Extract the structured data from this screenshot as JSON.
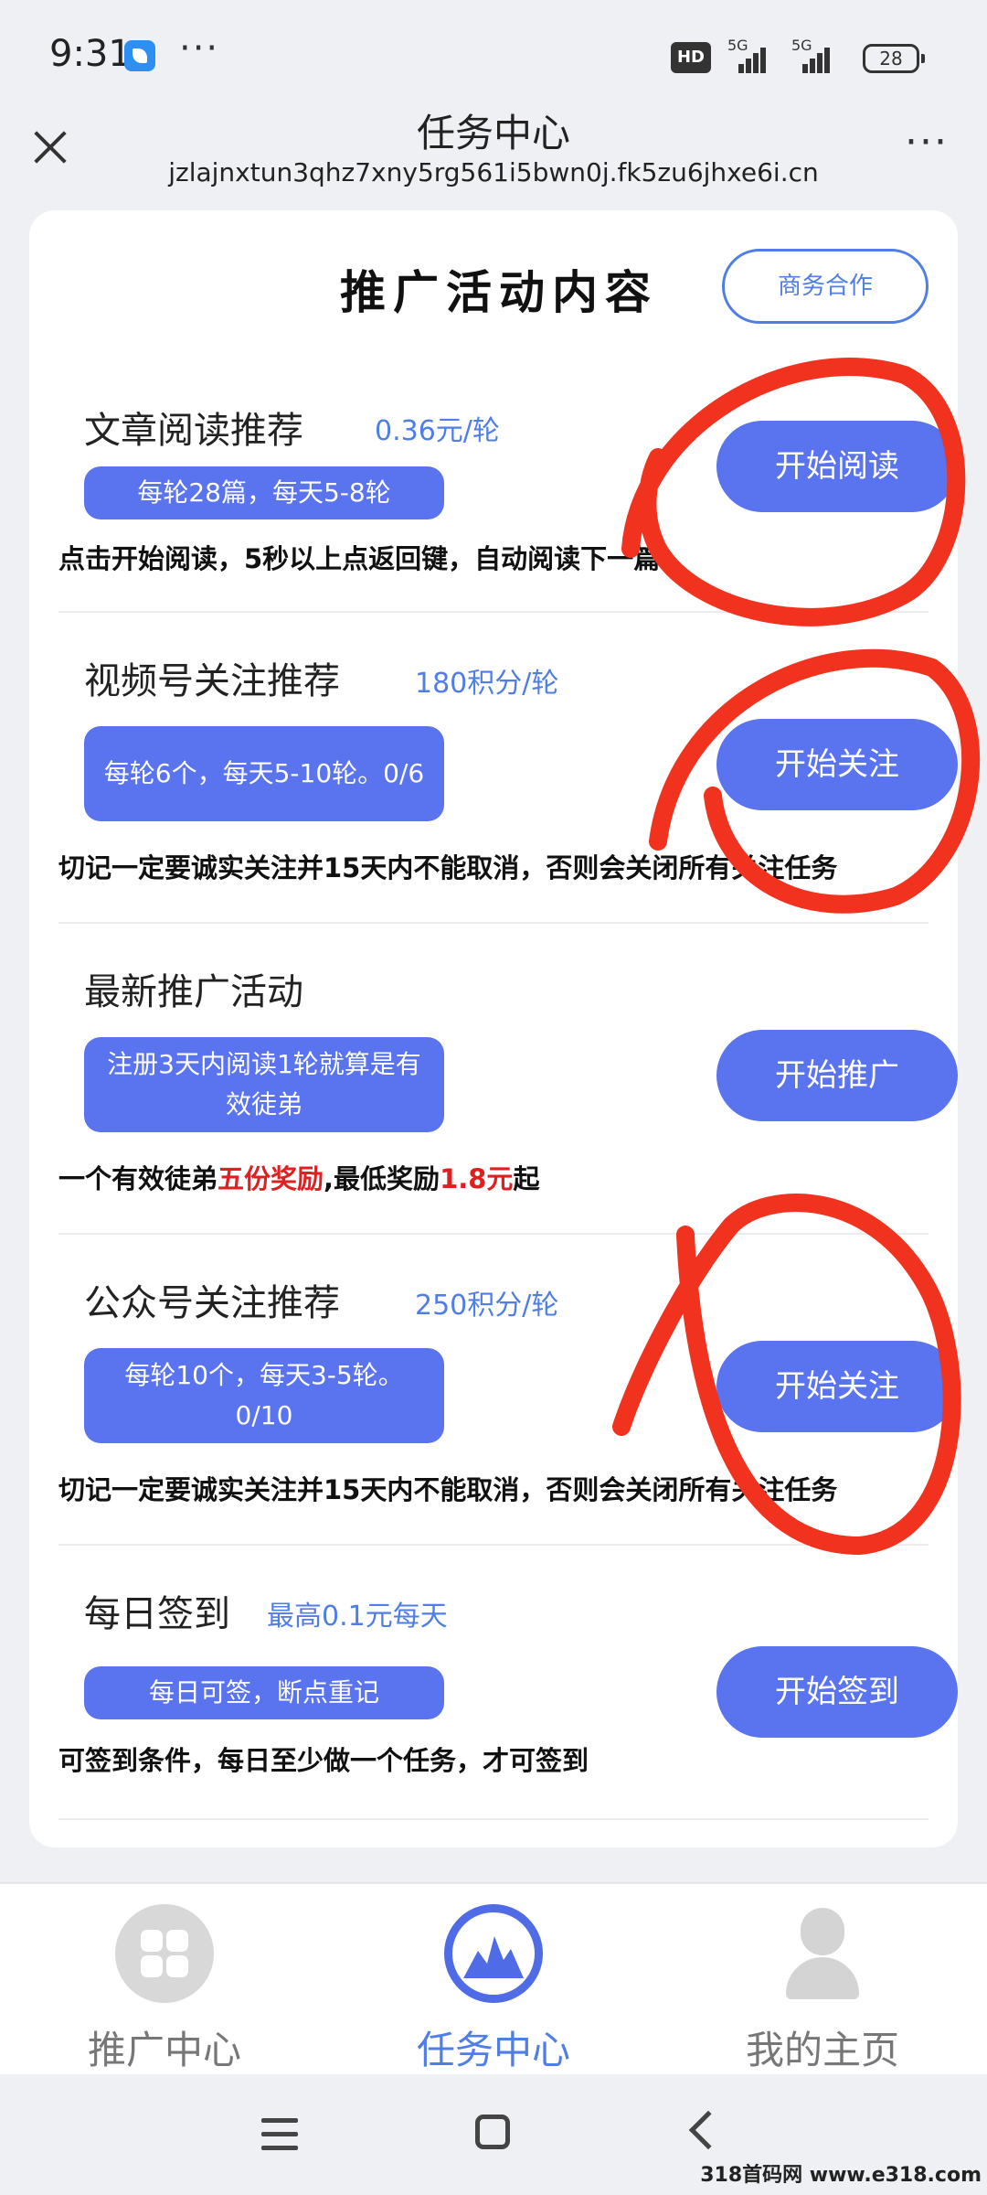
{
  "status_bar": {
    "time": "9:31",
    "more": "···",
    "hd": "HD",
    "network_1": "5G",
    "network_2": "5G",
    "battery": "28"
  },
  "header": {
    "title": "任务中心",
    "url": "jzlajnxtun3qhz7xny5rg561i5bwn0j.fk5zu6jhxe6i.cn",
    "more": "···"
  },
  "card": {
    "title": "推广活动内容",
    "business_button": "商务合作"
  },
  "tasks": [
    {
      "name": "文章阅读推荐",
      "reward": "0.36元/轮",
      "tag": "每轮28篇，每天5-8轮",
      "desc": "点击开始阅读，5秒以上点返回键，自动阅读下一篇",
      "button": "开始阅读"
    },
    {
      "name": "视频号关注推荐",
      "reward": "180积分/轮",
      "tag": "每轮6个，每天5-10轮。0/6",
      "desc": "切记一定要诚实关注并15天内不能取消，否则会关闭所有关注任务",
      "button": "开始关注"
    },
    {
      "name": "最新推广活动",
      "reward": "",
      "tag": "注册3天内阅读1轮就算是有效徒弟",
      "desc_parts": [
        "一个有效徒弟",
        "五份奖励",
        ",最低奖励",
        "1.8元",
        "起"
      ],
      "button": "开始推广"
    },
    {
      "name": "公众号关注推荐",
      "reward": "250积分/轮",
      "tag": "每轮10个，每天3-5轮。0/10",
      "desc": "切记一定要诚实关注并15天内不能取消，否则会关闭所有关注任务",
      "button": "开始关注"
    },
    {
      "name": "每日签到",
      "reward": "最高0.1元每天",
      "tag": "每日可签，断点重记",
      "desc": "可签到条件，每日至少做一个任务，才可签到",
      "button": "开始签到"
    }
  ],
  "tabbar": {
    "items": [
      {
        "label": "推广中心",
        "icon": "grid-icon",
        "active": false
      },
      {
        "label": "任务中心",
        "icon": "task-icon",
        "active": true
      },
      {
        "label": "我的主页",
        "icon": "user-icon",
        "active": false
      }
    ]
  },
  "watermark": "318首码网 www.e318.com",
  "colors": {
    "accent": "#5a73ef",
    "reward_text": "#4f7ee6",
    "highlight": "#e02020",
    "annotation": "#f0321e",
    "inactive": "#777777"
  }
}
